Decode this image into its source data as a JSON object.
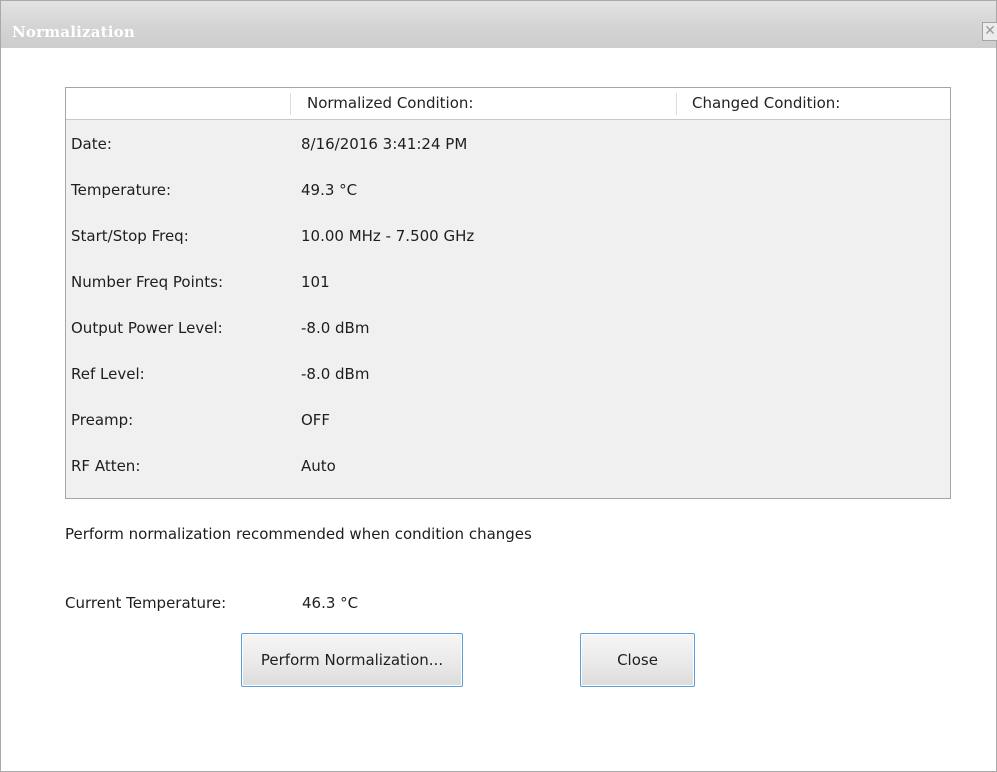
{
  "window": {
    "title": "Normalization",
    "close_glyph": "✕"
  },
  "table": {
    "headers": [
      "",
      "Normalized Condition:",
      "Changed Condition:"
    ],
    "rows": [
      {
        "label": "Date:",
        "normalized": "8/16/2016 3:41:24 PM",
        "changed": ""
      },
      {
        "label": "Temperature:",
        "normalized": "49.3 °C",
        "changed": ""
      },
      {
        "label": "Start/Stop Freq:",
        "normalized": "10.00 MHz - 7.500 GHz",
        "changed": ""
      },
      {
        "label": "Number Freq Points:",
        "normalized": "101",
        "changed": ""
      },
      {
        "label": "Output Power Level:",
        "normalized": "-8.0 dBm",
        "changed": ""
      },
      {
        "label": "Ref Level:",
        "normalized": "-8.0 dBm",
        "changed": ""
      },
      {
        "label": "Preamp:",
        "normalized": "OFF",
        "changed": ""
      },
      {
        "label": "RF Atten:",
        "normalized": "Auto",
        "changed": ""
      }
    ]
  },
  "note": "Perform normalization recommended when condition changes",
  "current_temperature": {
    "label": "Current Temperature:",
    "value": "46.3 °C"
  },
  "buttons": {
    "perform": "Perform Normalization...",
    "close": "Close"
  },
  "colors": {
    "title_bar": "#d4d4d4",
    "panel_background": "#f0f0f0",
    "button_border": "#5c9fd6"
  }
}
